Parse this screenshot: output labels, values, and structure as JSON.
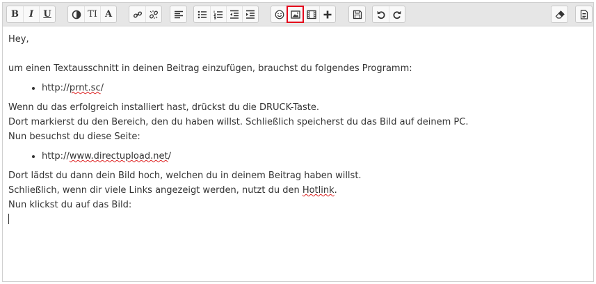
{
  "toolbar": {
    "groups": [
      {
        "name": "format",
        "buttons": [
          {
            "id": "bold",
            "label": "B"
          },
          {
            "id": "italic",
            "label": "I"
          },
          {
            "id": "underline",
            "label": "U"
          }
        ]
      },
      {
        "name": "style",
        "buttons": [
          {
            "id": "color-icon"
          },
          {
            "id": "size",
            "label": "TI"
          },
          {
            "id": "font",
            "label": "A"
          }
        ]
      },
      {
        "name": "link",
        "buttons": [
          {
            "id": "link-icon"
          },
          {
            "id": "unlink-icon"
          }
        ]
      },
      {
        "name": "align",
        "buttons": [
          {
            "id": "align-left-icon"
          }
        ]
      },
      {
        "name": "list",
        "buttons": [
          {
            "id": "bullet-list-icon"
          },
          {
            "id": "numbered-list-icon"
          },
          {
            "id": "outdent-icon"
          },
          {
            "id": "indent-icon"
          }
        ]
      },
      {
        "name": "insert",
        "buttons": [
          {
            "id": "smiley-icon"
          },
          {
            "id": "image-icon",
            "highlighted": true
          },
          {
            "id": "video-icon"
          },
          {
            "id": "plus-icon"
          }
        ]
      },
      {
        "name": "save",
        "buttons": [
          {
            "id": "save-icon"
          }
        ]
      },
      {
        "name": "history",
        "buttons": [
          {
            "id": "undo-icon"
          },
          {
            "id": "redo-icon"
          }
        ]
      },
      {
        "name": "eraser",
        "buttons": [
          {
            "id": "eraser-icon"
          }
        ]
      },
      {
        "name": "source",
        "buttons": [
          {
            "id": "document-icon"
          }
        ]
      }
    ],
    "highlight_color": "#e3001b"
  },
  "content": {
    "greeting": "Hey,",
    "intro": "um einen Textausschnitt in deinen Beitrag einzufügen, brauchst du folgendes Programm:",
    "link1_prefix": "http://",
    "link1_word": "prnt.sc",
    "link1_suffix": "/",
    "para2_line1": "Wenn du das erfolgreich installiert hast, drückst du die DRUCK-Taste.",
    "para2_line2": "Dort markierst du den Bereich, den du haben willst. Schließlich speicherst du das Bild auf deinem PC.",
    "para2_line3": "Nun besuchst du diese Seite:",
    "link2_prefix": "http://",
    "link2_word": "www.directupload.net",
    "link2_suffix": "/",
    "para3_line1": "Dort lädst du dann dein Bild hoch, welchen du in deinem Beitrag haben willst.",
    "para3_line2_before": "Schließlich, wenn dir viele Links angezeigt werden, nutzt du den ",
    "para3_line2_word": "Hotlink",
    "para3_line2_after": ".",
    "para3_line3": "Nun klickst du auf das Bild:"
  }
}
